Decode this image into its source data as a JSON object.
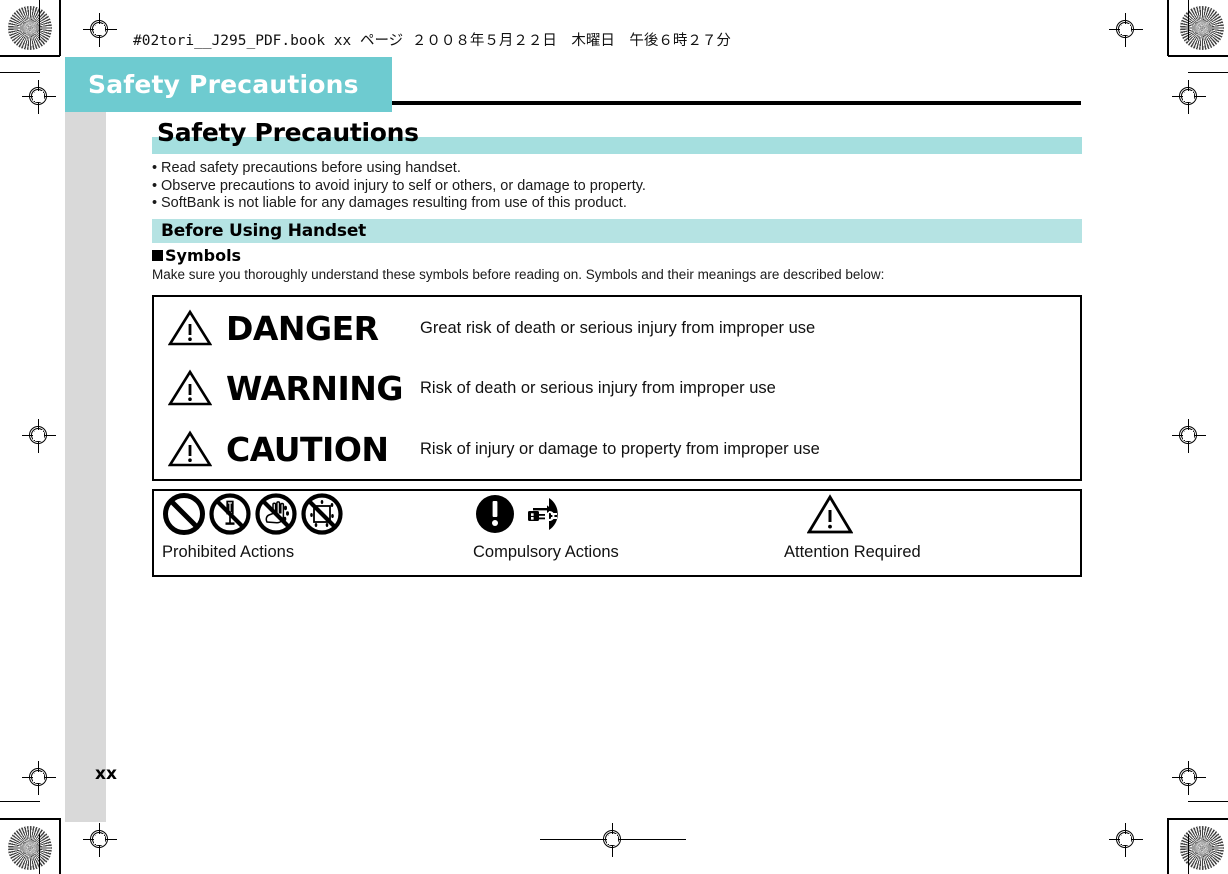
{
  "print_header": {
    "text": "#02tori__J295_PDF.book  xx ページ  ２００８年５月２２日　木曜日　午後６時２７分"
  },
  "chapter_tab": {
    "label": "Safety Precautions"
  },
  "page": {
    "title": "Safety Precautions",
    "page_number": "xx"
  },
  "intro_bullets": [
    "Read safety precautions before using handset.",
    "Observe precautions to avoid injury to self or others, or damage to property.",
    "SoftBank is not liable for any damages resulting from use of this product."
  ],
  "section": {
    "band_title": "Before Using Handset",
    "sub_head": "Symbols",
    "lead": "Make sure you thoroughly understand these symbols before reading on. Symbols and their meanings are described below:"
  },
  "levels": [
    {
      "icon": "warning-triangle-icon",
      "name": "DANGER",
      "desc": "Great risk of death or serious injury from improper use"
    },
    {
      "icon": "warning-triangle-icon",
      "name": "WARNING",
      "desc": "Risk of death or serious injury from improper use"
    },
    {
      "icon": "warning-triangle-icon",
      "name": "CAUTION",
      "desc": "Risk of injury or damage to property from improper use"
    }
  ],
  "symbol_groups": [
    {
      "caption": "Prohibited Actions",
      "icons": [
        "prohibited-general-icon",
        "prohibited-disassembly-icon",
        "prohibited-wet-hands-icon",
        "prohibited-water-icon"
      ]
    },
    {
      "caption": "Compulsory Actions",
      "icons": [
        "compulsory-general-icon",
        "compulsory-unplug-icon"
      ]
    },
    {
      "caption": "Attention Required",
      "icons": [
        "attention-triangle-icon"
      ]
    }
  ],
  "colors": {
    "tab_teal": "#6ECBD0",
    "band_light_teal": "#A5DFDF",
    "section_teal": "#B5E3E3",
    "sidebar_gray": "#D9D9D9"
  }
}
